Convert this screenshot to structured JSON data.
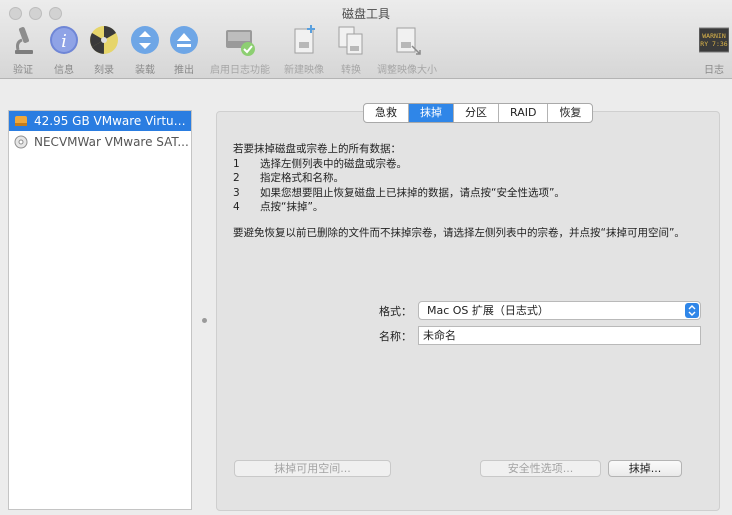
{
  "window": {
    "title": "磁盘工具"
  },
  "toolbar": {
    "items": [
      {
        "label": "验证",
        "icon": "microscope-icon"
      },
      {
        "label": "信息",
        "icon": "info-icon"
      },
      {
        "label": "刻录",
        "icon": "burn-icon"
      },
      {
        "label": "装载",
        "icon": "mount-icon"
      },
      {
        "label": "推出",
        "icon": "eject-icon"
      },
      {
        "label": "启用日志功能",
        "icon": "journal-icon"
      },
      {
        "label": "新建映像",
        "icon": "new-image-icon"
      },
      {
        "label": "转换",
        "icon": "convert-icon"
      },
      {
        "label": "调整映像大小",
        "icon": "resize-image-icon"
      },
      {
        "label": "日志",
        "icon": "log-icon"
      }
    ],
    "log_badge_line1": "WARNIN",
    "log_badge_line2": "RY 7:36"
  },
  "sidebar": {
    "items": [
      {
        "label": "42.95 GB VMware Virtua...",
        "selected": true
      },
      {
        "label": "NECVMWar VMware SAT...",
        "selected": false
      }
    ]
  },
  "tabs": [
    {
      "label": "急救",
      "active": false
    },
    {
      "label": "抹掉",
      "active": true
    },
    {
      "label": "分区",
      "active": false
    },
    {
      "label": "RAID",
      "active": false
    },
    {
      "label": "恢复",
      "active": false
    }
  ],
  "erase": {
    "intro": "若要抹掉磁盘或宗卷上的所有数据：",
    "steps": [
      {
        "num": "1",
        "text": "选择左侧列表中的磁盘或宗卷。"
      },
      {
        "num": "2",
        "text": "指定格式和名称。"
      },
      {
        "num": "3",
        "text": "如果您想要阻止恢复磁盘上已抹掉的数据，请点按“安全性选项”。"
      },
      {
        "num": "4",
        "text": "点按“抹掉”。"
      }
    ],
    "note": "要避免恢复以前已删除的文件而不抹掉宗卷，请选择左侧列表中的宗卷，并点按“抹掉可用空间”。",
    "format_label": "格式：",
    "format_value": "Mac OS 扩展（日志式）",
    "name_label": "名称：",
    "name_value": "未命名",
    "erase_free_space": "抹掉可用空间...",
    "security_options": "安全性选项...",
    "erase_button": "抹掉..."
  },
  "colors": {
    "accent": "#2f86e8",
    "selection": "#2a7de1"
  }
}
